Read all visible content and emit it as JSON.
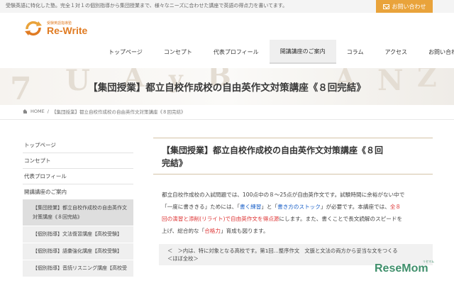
{
  "topbar": {
    "text": "受験英語に特化した塾。完全１対１の個別指導から集団授業まで、様々なニーズに合わせた講座で英語の得点力を書いてます。",
    "contact_label": "お問い合わせ"
  },
  "logo": {
    "small": "受験英語指導塾",
    "name": "Re-Write"
  },
  "nav": [
    "トップページ",
    "コンセプト",
    "代表プロフィール",
    "開講講座のご案内",
    "コラム",
    "アクセス",
    "お問い合わせ"
  ],
  "hero": {
    "title": "【集団授業】都立自校作成校の自由英作文対策講座《８回完結》"
  },
  "breadcrumb": {
    "home": "HOME",
    "sep": "/",
    "current": "【集団授業】都立自校作成校の自由英作文対策講座《８回完結》"
  },
  "sidebar": {
    "items": [
      "トップページ",
      "コンセプト",
      "代表プロフィール",
      "開講講座のご案内"
    ],
    "sub_items": [
      {
        "line1": "【集団授業】都立自校作成校の自由英作文",
        "line2": "対策講座《８回完結》"
      },
      {
        "line1": "【個別指導】文法復習講座【高校受験】"
      },
      {
        "line1": "【個別指導】語彙強化講座【高校受験】"
      },
      {
        "line1": "【個別指導】音読リスニング講座【高校受"
      }
    ]
  },
  "main": {
    "title_line1": "【集団授業】都立自校作成校の自由英作文対策講座《８回",
    "title_line2": "完結》",
    "p_line1": "都立自校作成校の入試問題では、100点中の８～25点が自由英作文です。試験時間に余裕がない中で",
    "p_line2_a": "「一度に書ききる」ためには、「",
    "p_line2_b": "書く練習",
    "p_line2_c": "」と「",
    "p_line2_d": "書き方のストック",
    "p_line2_e": "」が必要です。本講座では、",
    "p_line2_f": "全８",
    "p_line3_a": "回の演習と添削(リライト)で自由英作文を得点源",
    "p_line3_b": "にします。また、書くことで長文読解のスピードを",
    "p_line4_a": "上げ、総合的な「",
    "p_line4_b": "合格力",
    "p_line4_c": "」育成も図ります。",
    "note_line1": "＜　＞内は、特に対象となる高校です。第1回…整序作文　文脈と文法の両方から妥当な文をつくる",
    "note_line2": "＜ほぼ全校＞"
  },
  "watermark": {
    "name": "ReseMom",
    "small": "リセマム"
  },
  "colors": {
    "accent": "#e9a33b",
    "logo": "#e07b22",
    "link": "#1a60c8",
    "emphasis": "#dd3333",
    "watermark": "#3f8f6b"
  },
  "icons": {
    "contact": "mail-icon",
    "breadcrumb": "home-icon"
  }
}
